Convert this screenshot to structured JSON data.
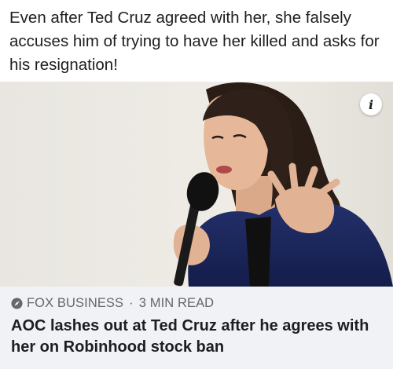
{
  "post": {
    "text": "Even after Ted Cruz agreed with her, she falsely accuses him of trying to have her killed and asks for his resignation!"
  },
  "link_card": {
    "image_alt": "Woman speaking into a microphone",
    "info_icon": "info-icon",
    "info_glyph": "i",
    "source_icon": "compass-icon",
    "source": "FOX BUSINESS",
    "separator": "·",
    "read_time": "3 MIN READ",
    "headline": "AOC lashes out at Ted Cruz after he agrees with her on Robinhood stock ban"
  },
  "colors": {
    "meta_background": "#f0f2f5",
    "meta_text": "#65676b",
    "primary_text": "#1c1e21"
  }
}
